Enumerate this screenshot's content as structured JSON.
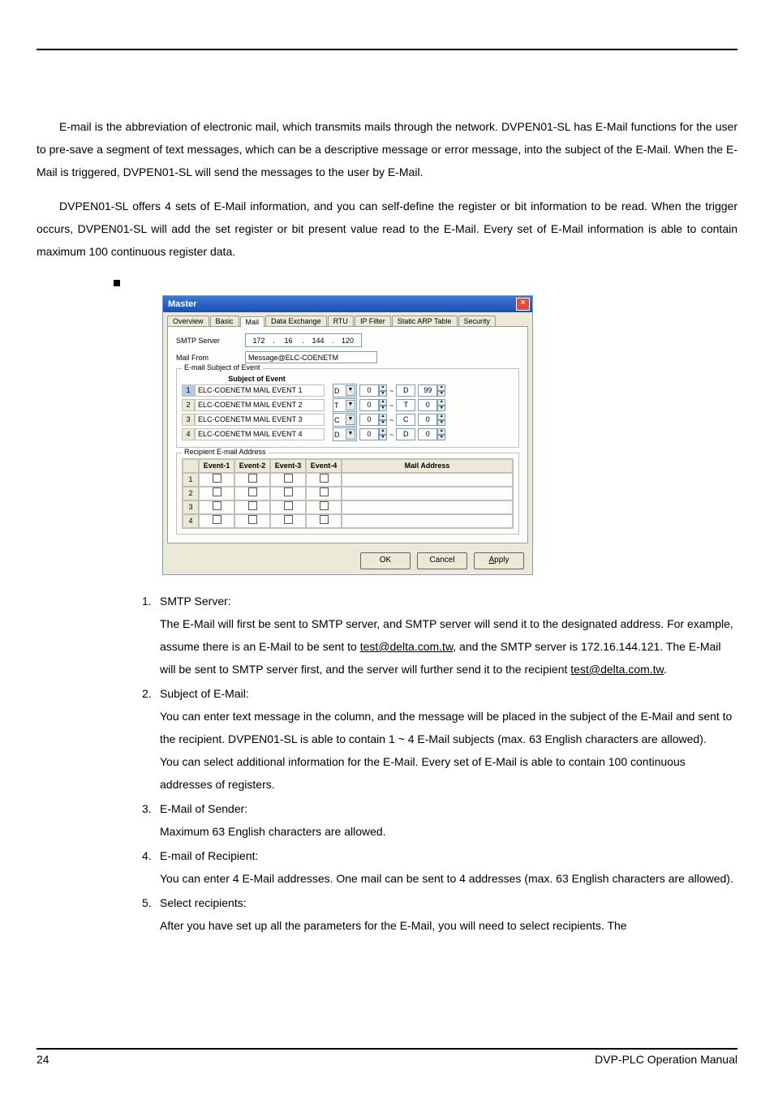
{
  "paragraph1": "E-mail is the abbreviation of electronic mail, which transmits mails through the network. DVPEN01-SL has E-Mail functions for the user to pre-save a segment of text messages, which can be a descriptive message or error message, into the subject of the E-Mail. When the E-Mail is triggered, DVPEN01-SL will send the messages to the user by E-Mail.",
  "paragraph2": "DVPEN01-SL offers 4 sets of E-Mail information, and you can self-define the register or bit information to be read. When the trigger occurs, DVPEN01-SL will add the set register or bit present value read to the E-Mail. Every set of E-Mail information is able to contain maximum 100 continuous register data.",
  "dialog": {
    "title": "Master",
    "tabs": [
      "Overview",
      "Basic",
      "Mail",
      "Data Exchange",
      "RTU",
      "IP Filter",
      "Static ARP Table",
      "Security"
    ],
    "active_tab": "Mail",
    "smtp_label": "SMTP Server",
    "smtp_ip": [
      "172",
      "16",
      "144",
      "120"
    ],
    "mailfrom_label": "Mail From",
    "mailfrom_value": "Message@ELC-COENETM",
    "group_subject": "E-mail Subject of Event",
    "subject_header": "Subject of Event",
    "events": [
      {
        "n": "1",
        "name": "ELC-COENETM MAIL EVENT 1",
        "a": "D",
        "b": "0",
        "c": "D",
        "d": "99"
      },
      {
        "n": "2",
        "name": "ELC-COENETM MAIL EVENT 2",
        "a": "T",
        "b": "0",
        "c": "T",
        "d": "0"
      },
      {
        "n": "3",
        "name": "ELC-COENETM MAIL EVENT 3",
        "a": "C",
        "b": "0",
        "c": "C",
        "d": "0"
      },
      {
        "n": "4",
        "name": "ELC-COENETM MAIL EVENT 4",
        "a": "D",
        "b": "0",
        "c": "D",
        "d": "0"
      }
    ],
    "group_recipient": "Recipient E-mail Address",
    "rec_headers": [
      "",
      "Event-1",
      "Event-2",
      "Event-3",
      "Event-4",
      "Mail Address"
    ],
    "rec_rows": [
      "1",
      "2",
      "3",
      "4"
    ],
    "buttons": {
      "ok": "OK",
      "cancel": "Cancel",
      "apply": "Apply"
    }
  },
  "items": {
    "i1_title": "SMTP Server:",
    "i1_p1a": "The E-Mail will first be sent to SMTP server, and SMTP server will send it to the designated address. For example, assume there is an E-Mail to be sent to ",
    "i1_link1": "test@delta.com.tw",
    "i1_p1b": ", and the SMTP server is 172.16.144.121. The E-Mail will be sent to SMTP server first, and the server will further send it to the recipient ",
    "i1_link2": "test@delta.com.tw",
    "i1_p1c": ".",
    "i2_title": "Subject of E-Mail:",
    "i2_p1": "You can enter text message in the column, and the message will be placed in the subject of the E-Mail and sent to the recipient. DVPEN01-SL is able to contain 1 ~ 4 E-Mail subjects (max. 63 English characters are allowed).",
    "i2_p2": "You can select additional information for the E-Mail. Every set of E-Mail is able to contain 100 continuous addresses of registers.",
    "i3_title": "E-Mail of Sender:",
    "i3_p1": "Maximum 63 English characters are allowed.",
    "i4_title": "E-mail of Recipient:",
    "i4_p1": "You can enter 4 E-Mail addresses. One mail can be sent to 4 addresses (max. 63 English characters are allowed).",
    "i5_title": "Select recipients:",
    "i5_p1": "After you have set up all the parameters for the E-Mail, you will need to select recipients. The"
  },
  "footer": {
    "page": "24",
    "doc": "DVP-PLC  Operation  Manual"
  }
}
